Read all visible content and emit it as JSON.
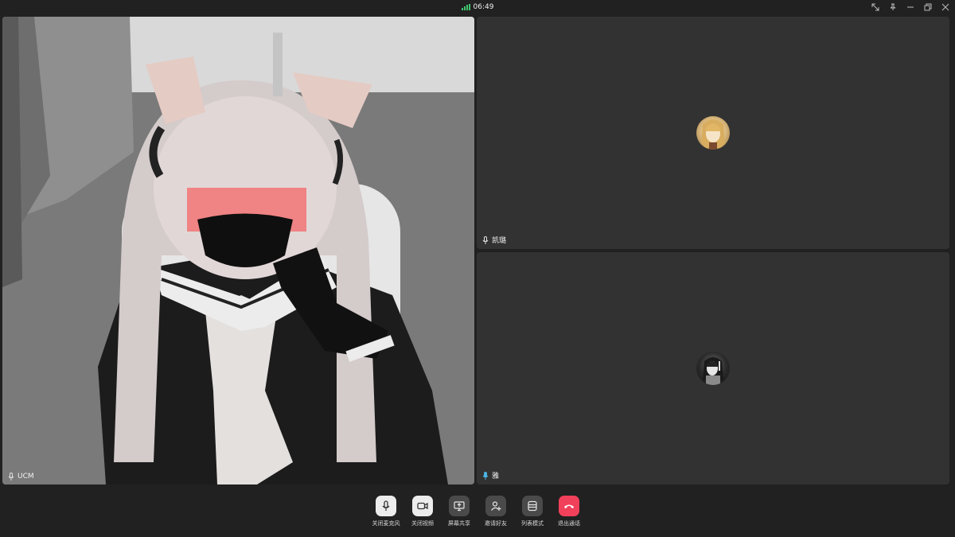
{
  "status": {
    "time": "06:49"
  },
  "window_controls": [
    "shrink-icon",
    "pin-icon",
    "minimize-icon",
    "restore-icon",
    "close-icon"
  ],
  "participants": [
    {
      "name": "UCM",
      "video": true
    },
    {
      "name": "凯璐",
      "video": false
    },
    {
      "name": "雅",
      "video": false,
      "mic_color": "#4db3e6"
    }
  ],
  "toolbar": {
    "mute_label": "关闭麦克风",
    "camera_label": "关闭视频",
    "share_label": "屏幕共享",
    "invite_label": "邀请好友",
    "layout_label": "列表模式",
    "leave_label": "退出通话"
  },
  "colors": {
    "accent_green": "#3ec46d",
    "danger": "#f1405a",
    "background": "#212121",
    "tile": "#323232"
  }
}
